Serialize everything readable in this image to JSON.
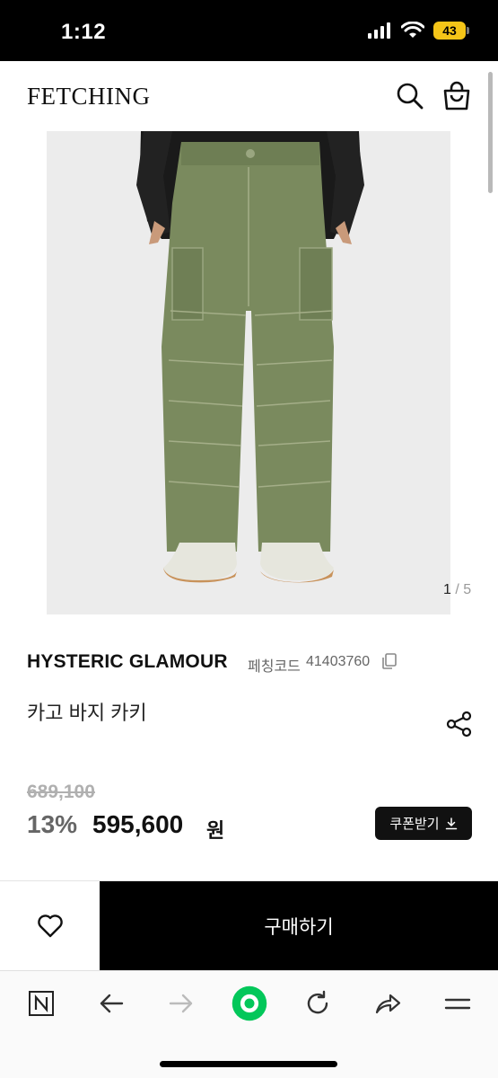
{
  "status": {
    "time": "1:12",
    "battery": "43"
  },
  "header": {
    "logo": "FETCHING"
  },
  "image": {
    "current": "1",
    "separator": " / ",
    "total": "5"
  },
  "product": {
    "brand": "HYSTERIC GLAMOUR",
    "code_label": "페칭코드",
    "code": "41403760",
    "name": "카고 바지 카키",
    "original_price": "689,100",
    "discount": "13%",
    "price": "595,600",
    "currency": "원"
  },
  "actions": {
    "coupon_label": "쿠폰받기",
    "buy_label": "구매하기"
  },
  "colors": {
    "accent": "#000000",
    "pants": "#7a8a5e",
    "background": "#ececec"
  },
  "icons": {
    "header": [
      "search-icon",
      "shopping-bag-icon"
    ],
    "browser": [
      "naver-n-icon",
      "back-arrow-icon",
      "forward-arrow-icon",
      "home-circle-icon",
      "refresh-icon",
      "share-arrow-icon",
      "menu-icon"
    ]
  }
}
